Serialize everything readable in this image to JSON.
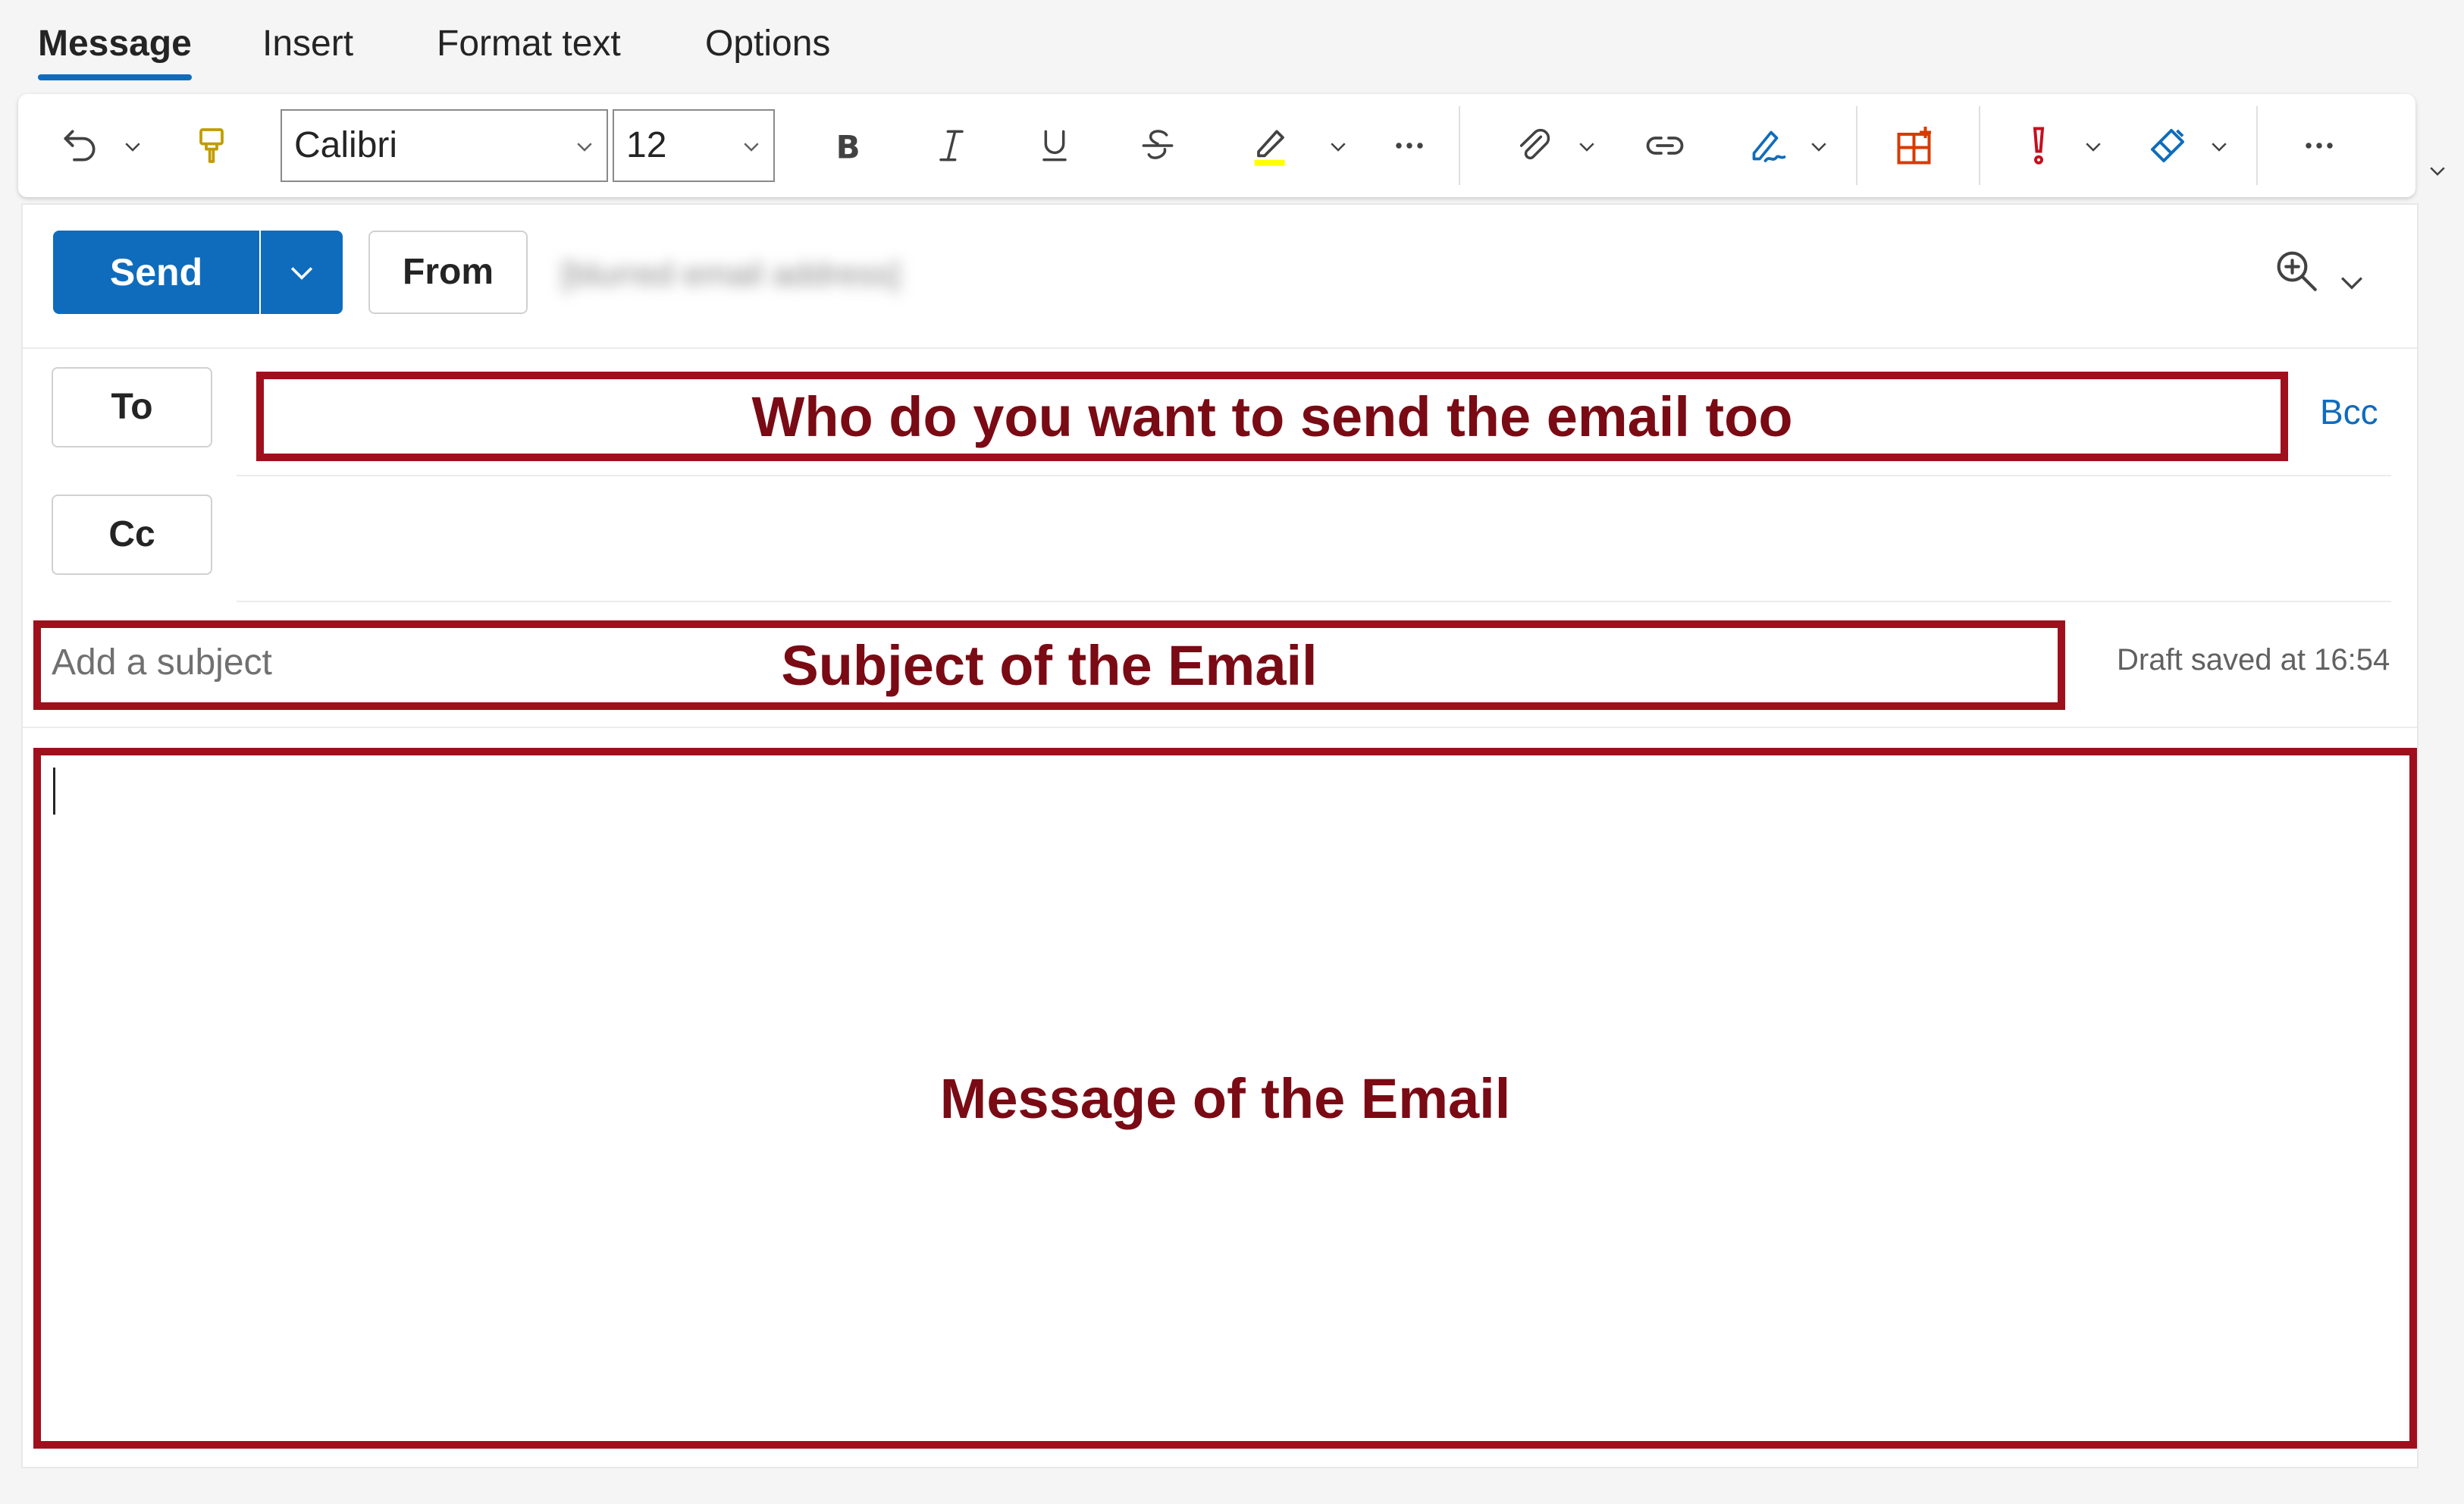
{
  "tabs": [
    {
      "label": "Message",
      "active": true
    },
    {
      "label": "Insert"
    },
    {
      "label": "Format text"
    },
    {
      "label": "Options"
    }
  ],
  "toolbar": {
    "font_family": "Calibri",
    "font_size": "12",
    "icons": [
      "undo-icon",
      "format-painter-icon",
      "bold-icon",
      "italic-icon",
      "underline-icon",
      "strikethrough-icon",
      "highlight-icon",
      "more-icon",
      "attach-icon",
      "link-icon",
      "signature-icon",
      "apps-icon",
      "importance-icon",
      "sensitivity-icon",
      "more-icon"
    ],
    "highlight_color": "#ffff00"
  },
  "compose": {
    "send_label": "Send",
    "from_label": "From",
    "from_address": "[blurred email address]",
    "to_label": "To",
    "cc_label": "Cc",
    "bcc_label": "Bcc",
    "subject_placeholder": "Add a subject",
    "draft_status": "Draft saved at 16:54"
  },
  "annotations": {
    "to": "Who do you want to send the email too",
    "subject": "Subject of the Email",
    "body": "Message of the Email"
  },
  "colors": {
    "accent": "#0f6cbd",
    "annotation_border": "#a00f1c",
    "annotation_text": "#7a0a14",
    "alert": "#c50f1f",
    "office_orange": "#d83b01"
  }
}
